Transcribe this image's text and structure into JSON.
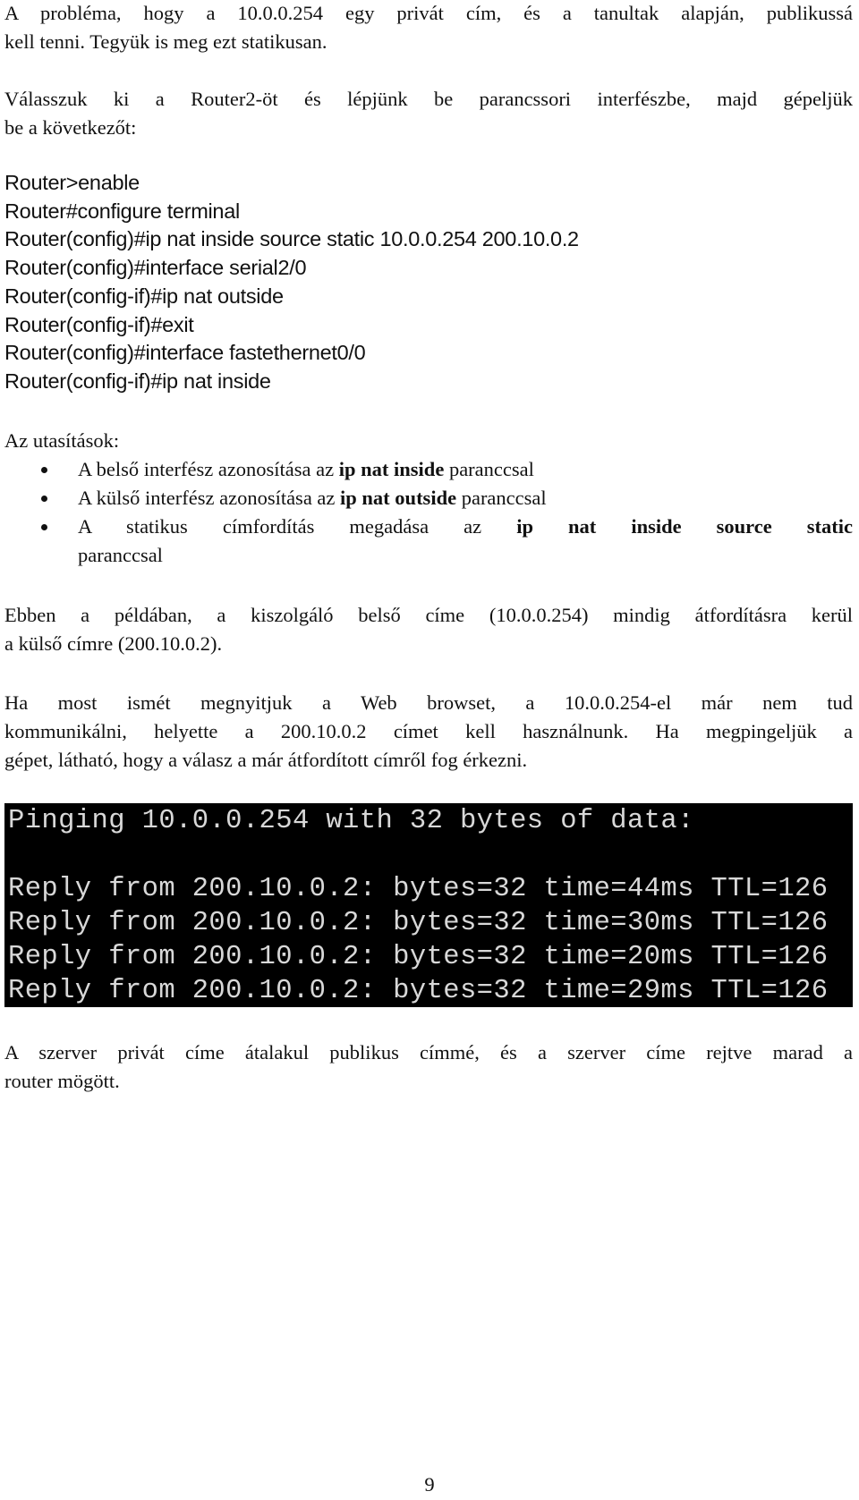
{
  "intro": {
    "lines": [
      "A probléma, hogy a 10.0.0.254 egy privát cím, és a tanultak alapján, publikussá",
      "kell tenni. Tegyük is meg ezt statikusan."
    ]
  },
  "instruction": {
    "lines": [
      "Válasszuk ki a Router2-öt és lépjünk be parancssori interfészbe, majd gépeljük",
      "be a következőt:"
    ]
  },
  "commands": [
    "Router>enable",
    "Router#configure terminal",
    "Router(config)#ip nat inside source static 10.0.0.254 200.10.0.2",
    "Router(config)#interface serial2/0",
    "Router(config-if)#ip nat outside",
    "Router(config-if)#exit",
    "Router(config)#interface fastethernet0/0",
    "Router(config-if)#ip nat inside"
  ],
  "steps": {
    "heading": "Az utasítások:",
    "items": [
      {
        "pre": "A belső interfész azonosítása az ",
        "bold": "ip nat inside",
        "post": " paranccsal"
      },
      {
        "pre": "A külső interfész azonosítása az ",
        "bold": "ip nat outside",
        "post": " paranccsal"
      },
      {
        "pre": "A statikus címfordítás megadása az ",
        "bold": "ip nat inside source static",
        "post": "",
        "cont": "paranccsal"
      }
    ]
  },
  "example": {
    "lines": [
      "Ebben a példában, a kiszolgáló belső címe (10.0.0.254) mindig átfordításra kerül",
      "a külső címre (200.10.0.2)."
    ]
  },
  "browser_note": {
    "lines": [
      "Ha most ismét megnyitjuk a Web browset, a 10.0.0.254-el már nem tud",
      "kommunikálni, helyette a 200.10.0.2 címet kell használnunk. Ha megpingeljük a",
      "gépet, látható, hogy a válasz a már átfordított címről fog érkezni."
    ]
  },
  "terminal": {
    "header": "Pinging 10.0.0.254 with 32 bytes of data:",
    "replies": [
      "Reply from 200.10.0.2: bytes=32 time=44ms TTL=126",
      "Reply from 200.10.0.2: bytes=32 time=30ms TTL=126",
      "Reply from 200.10.0.2: bytes=32 time=20ms TTL=126",
      "Reply from 200.10.0.2: bytes=32 time=29ms TTL=126"
    ],
    "background": "#000000",
    "text_color": "#d8d8d8"
  },
  "conclusion": {
    "lines": [
      "A szerver privát címe átalakul publikus címmé, és a szerver címe rejtve marad a",
      "router mögött."
    ]
  },
  "page_number": "9"
}
